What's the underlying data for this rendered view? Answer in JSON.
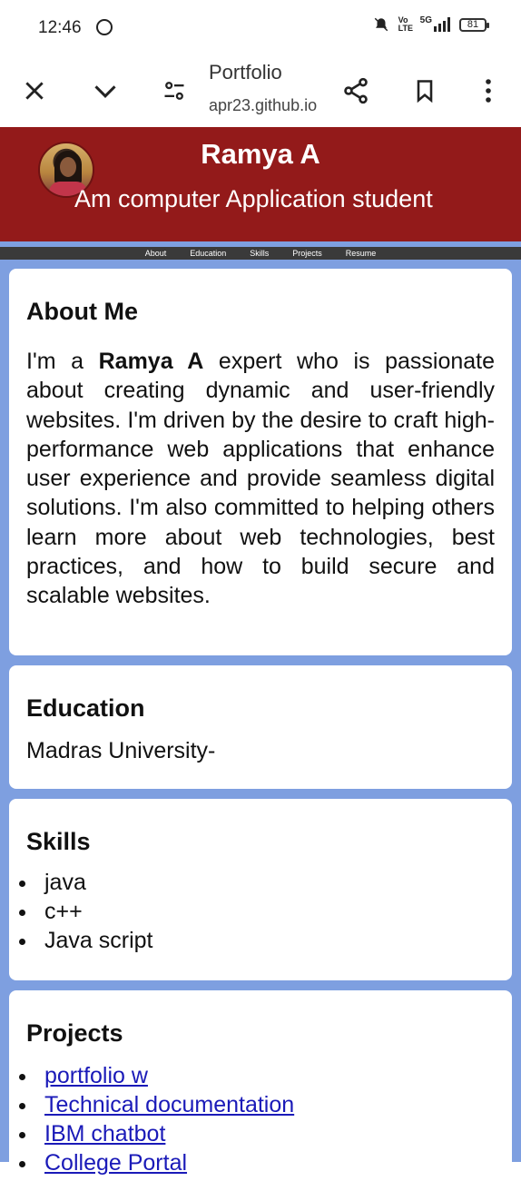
{
  "status_bar": {
    "time": "12:46",
    "network_label": "Vo LTE",
    "signal_label": "5G",
    "battery": "81"
  },
  "browser": {
    "title": "Portfolio",
    "url": "apr23.github.io"
  },
  "site": {
    "name": "Ramya A",
    "tagline": "Am computer Application student"
  },
  "nav": [
    "About",
    "Education",
    "Skills",
    "Projects",
    "Resume"
  ],
  "about": {
    "heading": "About Me",
    "text_before": "I'm a ",
    "name_bold": "Ramya A",
    "text_after": " expert who is passionate about creating dynamic and user-friendly websites. I'm driven by the desire to craft high-performance web applications that enhance user experience and provide seamless digital solutions. I'm also committed to helping others learn more about web technologies, best practices, and how to build secure and scalable websites."
  },
  "education": {
    "heading": "Education",
    "text": "Madras University-"
  },
  "skills": {
    "heading": "Skills",
    "items": [
      "java",
      "c++",
      "Java script"
    ]
  },
  "projects": {
    "heading": "Projects",
    "items": [
      "portfolio w",
      "Technical documentation",
      "IBM chatbot",
      "College Portal"
    ]
  },
  "colors": {
    "header_bg": "#931a1a",
    "page_bg": "#7e9fe0",
    "nav_bg": "#3a3a3a",
    "link": "#1a1ab8"
  }
}
